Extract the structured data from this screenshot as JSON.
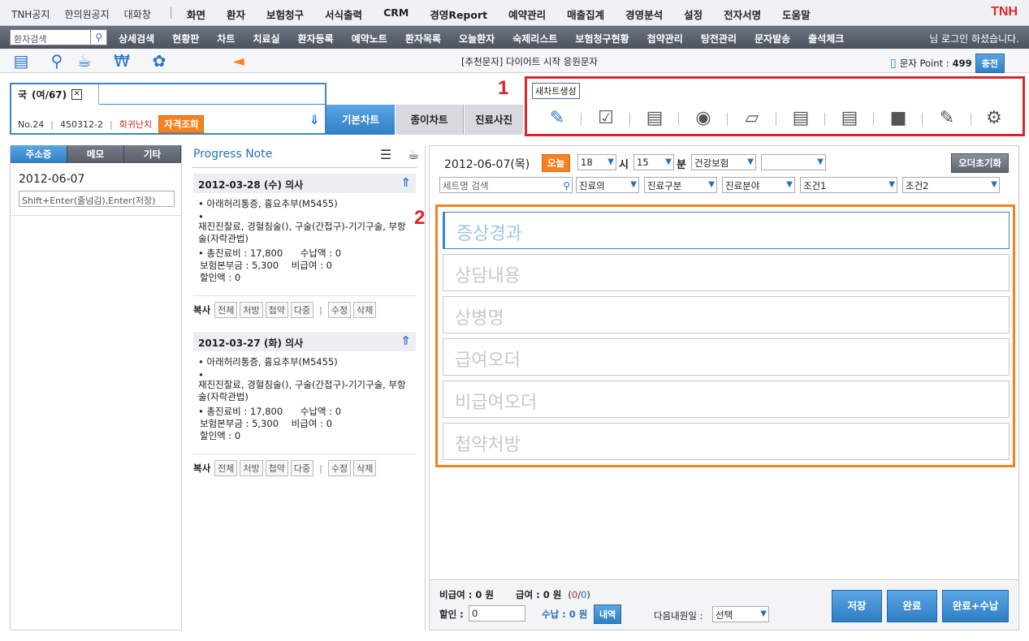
{
  "topmenu": {
    "left_items": [
      "TNH공지",
      "한의원공지",
      "대화창"
    ],
    "main_items": [
      "화면",
      "환자",
      "보험청구",
      "서식출력",
      "CRM",
      "경영Report",
      "예약관리",
      "매출집계",
      "경영분석",
      "설정",
      "전자서명",
      "도움말"
    ],
    "brand": "TNH"
  },
  "navbar": {
    "search_placeholder": "환자검색",
    "items": [
      "상세검색",
      "현황판",
      "차트",
      "치료실",
      "환자등록",
      "예약노트",
      "환자목록",
      "오늘환자",
      "숙제리스트",
      "보험청구현황",
      "첩약관리",
      "탕전관리",
      "문자발송",
      "출석체크"
    ],
    "login_text": "님 로그인 하셨습니다."
  },
  "toolrow": {
    "icons": [
      "monitor-icon",
      "doctor-icon",
      "medicine-bowl-icon",
      "money-bag-icon",
      "clover-icon"
    ],
    "notice": "[추천문자] 다이어트 시작 응원문자",
    "sms_label": "문자 Point :",
    "sms_points": "499",
    "charge_label": "충전"
  },
  "patient": {
    "tab_name": "국",
    "tab_info": "(여/67)",
    "no": "No.24",
    "id": "450312-2",
    "condition": "희귀난치",
    "eligibility_btn": "자격조회"
  },
  "chart_tabs": [
    "기본차트",
    "종이차트",
    "진료사진"
  ],
  "toolbox": {
    "tooltip": "새차트생성",
    "label": "1",
    "icons": [
      "chart-edit-icon",
      "checklist-icon",
      "laptop-icon",
      "award-icon",
      "id-badge-icon",
      "document-icon",
      "graph-icon",
      "folder-icon",
      "clipboard-icon",
      "settings-icon"
    ]
  },
  "sidebar": {
    "tabs": [
      "주소증",
      "메모",
      "기타"
    ],
    "date": "2012-06-07",
    "memo_placeholder": "Shift+Enter(줄넘김),Enter(저장)"
  },
  "progress_note": {
    "title": "Progress Note",
    "notes": [
      {
        "header": "2012-03-28 (수) 의사",
        "diag": "• 아래허리통증, 흉요추부(M5455)",
        "bullet": "•",
        "treat": "재진진찰료, 경혈침술(), 구술(간접구)-기기구술, 부항술(자락관법)",
        "fee1": "• 총진료비 : 17,800",
        "fee1b": "수납액 : 0",
        "fee2": "보험본부금 : 5,300",
        "fee2b": "비급여 : 0",
        "fee3": "할인액 : 0",
        "copy": "복사",
        "buttons": [
          "전체",
          "처방",
          "첩약",
          "다중"
        ],
        "sep": "|",
        "buttons2": [
          "수정",
          "삭제"
        ]
      },
      {
        "header": "2012-03-27 (화) 의사",
        "diag": "• 아래허리통증, 흉요추부(M5455)",
        "bullet": "•",
        "treat": "재진진찰료, 경혈침술(), 구술(간접구)-기기구술, 부항술(자락관법)",
        "fee1": "• 총진료비 : 17,800",
        "fee1b": "수납액 : 0",
        "fee2": "보험본부금 : 5,300",
        "fee2b": "비급여 : 0",
        "fee3": "할인액 : 0",
        "copy": "복사",
        "buttons": [
          "전체",
          "처방",
          "첩약",
          "다중"
        ],
        "sep": "|",
        "buttons2": [
          "수정",
          "삭제"
        ]
      }
    ]
  },
  "main": {
    "date": "2012-06-07(목)",
    "today": "오늘",
    "hour": "18",
    "hour_unit": "시",
    "minute": "15",
    "minute_unit": "분",
    "insurance": "건강보험",
    "empty_select": "",
    "reset": "오더초기화",
    "set_search": "세트명 검색",
    "filters": [
      "진료의",
      "진료구분",
      "진료분야",
      "조건1",
      "조건2"
    ],
    "sections_label": "2",
    "sections": [
      "증상경과",
      "상담내용",
      "상병명",
      "급여오더",
      "비급여오더",
      "첩약처방"
    ]
  },
  "bottom": {
    "nonpay": "비급여 : 0 원",
    "pay": "급여 : 0 원",
    "pay_paren_open": "(",
    "pay_red": "0",
    "pay_slash": "/",
    "pay_blue": "0",
    "pay_paren_close": ")",
    "discount_label": "할인 :",
    "discount_value": "0",
    "received": "수납 : 0 원",
    "detail": "내역",
    "next_visit_label": "다음내원일 :",
    "next_visit_value": "선택",
    "save": "저장",
    "complete": "완료",
    "complete_pay": "완료+수납"
  }
}
